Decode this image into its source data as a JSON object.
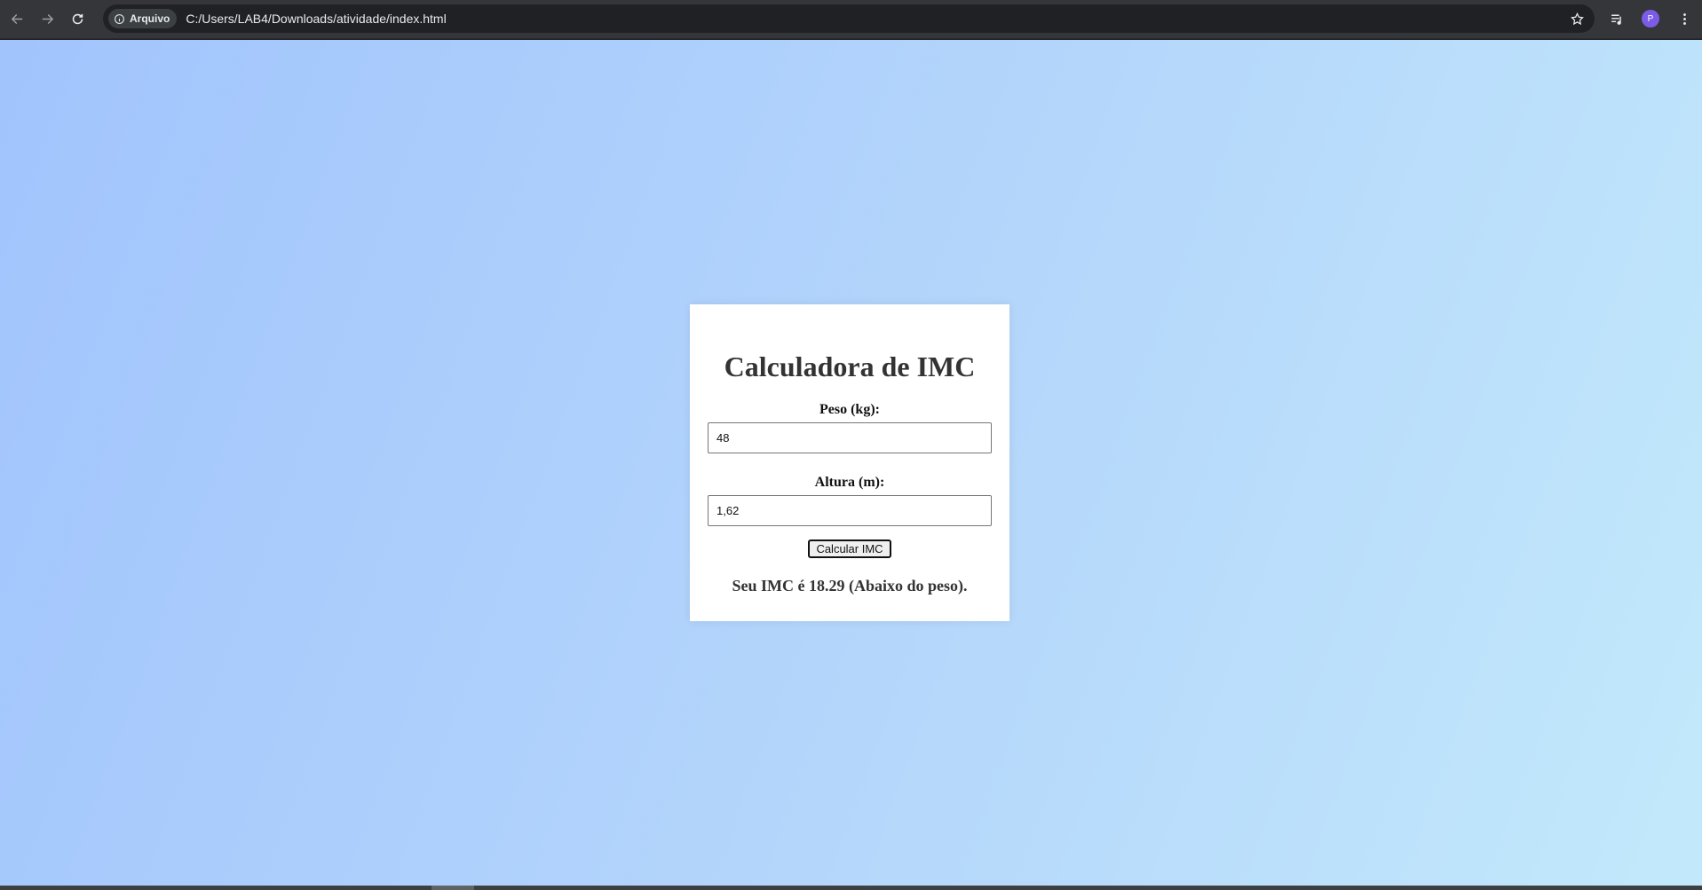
{
  "browser": {
    "site_chip_label": "Arquivo",
    "url": "C:/Users/LAB4/Downloads/atividade/index.html",
    "profile_initial": "P"
  },
  "icons": {
    "back": "arrow-left",
    "forward": "arrow-right",
    "reload": "refresh",
    "site_info": "info-circle",
    "bookmark": "star",
    "media": "playlist",
    "menu": "three-dots-vertical"
  },
  "colors": {
    "gradient_start": "#a1c4fd",
    "gradient_end": "#c2e9fb",
    "card_bg": "#ffffff",
    "avatar_bg": "#7b5ce6"
  },
  "calculator": {
    "title": "Calculadora de IMC",
    "weight_label": "Peso (kg):",
    "weight_value": "48",
    "height_label": "Altura (m):",
    "height_value": "1,62",
    "button_label": "Calcular IMC",
    "result_text": "Seu IMC é 18.29 (Abaixo do peso)."
  }
}
